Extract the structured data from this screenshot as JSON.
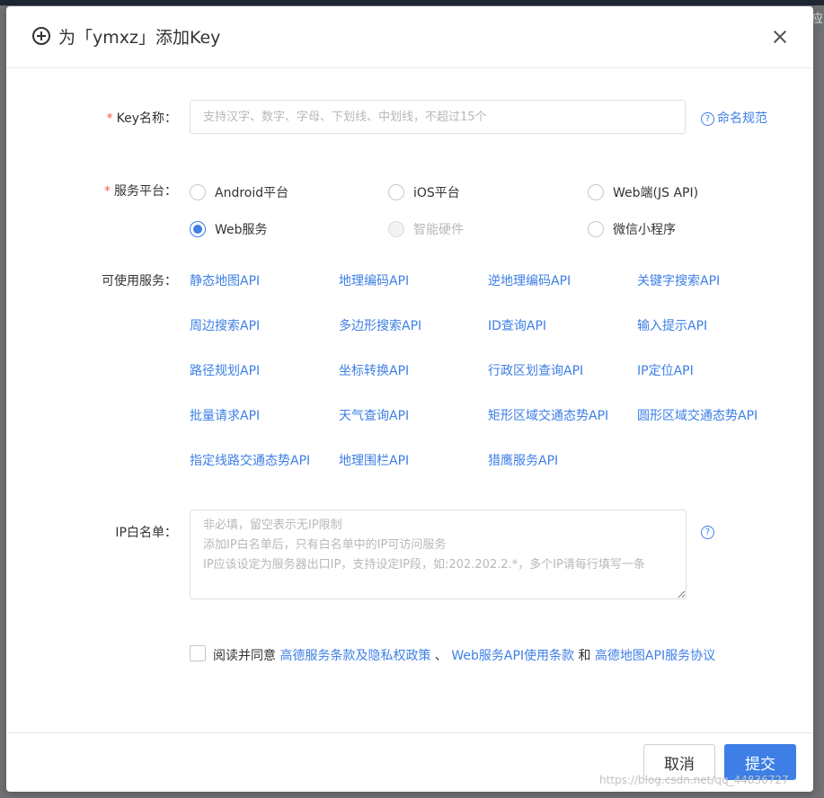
{
  "dialog": {
    "title": "为「ymxz」添加Key",
    "key_name": {
      "label": "Key名称：",
      "required_mark": "*",
      "placeholder": "支持汉字、数字、字母、下划线、中划线，不超过15个",
      "value": "",
      "help_link": "命名规范"
    },
    "platform": {
      "label": "服务平台：",
      "required_mark": "*",
      "options": [
        {
          "label": "Android平台",
          "checked": false,
          "disabled": false
        },
        {
          "label": "iOS平台",
          "checked": false,
          "disabled": false
        },
        {
          "label": "Web端(JS API)",
          "checked": false,
          "disabled": false
        },
        {
          "label": "Web服务",
          "checked": true,
          "disabled": false
        },
        {
          "label": "智能硬件",
          "checked": false,
          "disabled": true
        },
        {
          "label": "微信小程序",
          "checked": false,
          "disabled": false
        }
      ]
    },
    "services": {
      "label": "可使用服务：",
      "items": [
        "静态地图API",
        "地理编码API",
        "逆地理编码API",
        "关键字搜索API",
        "周边搜索API",
        "多边形搜索API",
        "ID查询API",
        "输入提示API",
        "路径规划API",
        "坐标转换API",
        "行政区划查询API",
        "IP定位API",
        "批量请求API",
        "天气查询API",
        "矩形区域交通态势API",
        "圆形区域交通态势API",
        "指定线路交通态势API",
        "地理围栏API",
        "猎鹰服务API"
      ]
    },
    "ip_whitelist": {
      "label": "IP白名单：",
      "placeholder": "非必填，留空表示无IP限制\n添加IP白名单后，只有白名单中的IP可访问服务\nIP应该设定为服务器出口IP，支持设定IP段，如:202.202.2.*，多个IP请每行填写一条",
      "value": ""
    },
    "agreement": {
      "prefix": "阅读并同意",
      "link1": "高德服务条款及隐私权政策",
      "sep1": "、",
      "link2": "Web服务API使用条款",
      "sep2": "和",
      "link3": "高德地图API服务协议",
      "checked": false
    },
    "buttons": {
      "cancel": "取消",
      "submit": "提交"
    }
  },
  "watermark": "https://blog.csdn.net/qq_44836727",
  "backdrop_glimpse": "应",
  "colors": {
    "accent": "#3d7fe6",
    "required": "#f25f4c",
    "overlay": "#6f7175"
  },
  "icons": {
    "title": "plus-circle-icon",
    "close": "close-icon",
    "help": "question-circle-icon"
  }
}
